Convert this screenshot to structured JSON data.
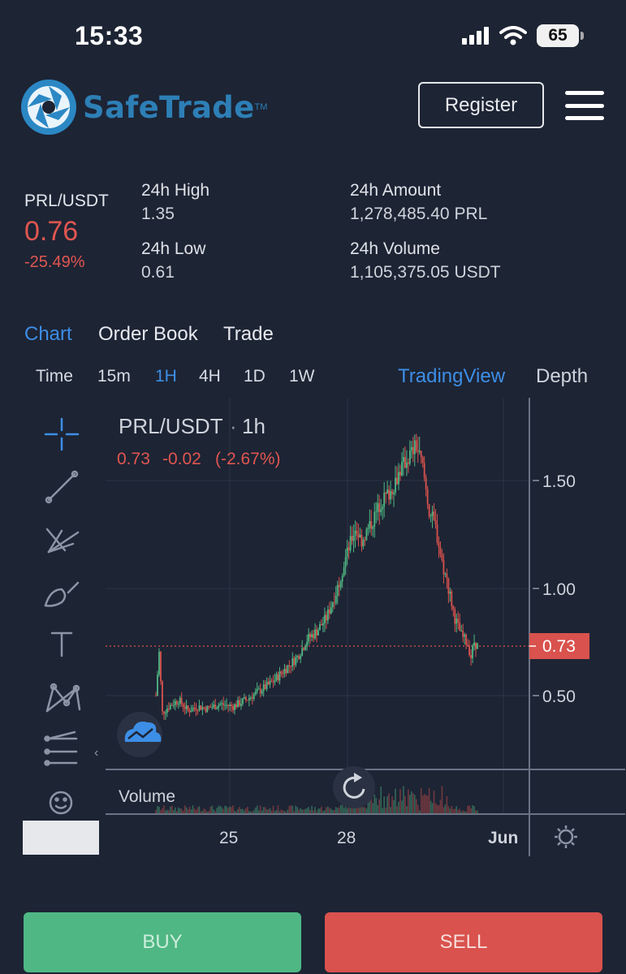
{
  "status_bar": {
    "time": "15:33",
    "battery": "65"
  },
  "header": {
    "logo_text": "SafeTrade",
    "logo_tm": "TM",
    "register_label": "Register"
  },
  "ticker": {
    "pair": "PRL/USDT",
    "price": "0.76",
    "change": "-25.49%",
    "stats": [
      {
        "label": "24h High",
        "value": "1.35"
      },
      {
        "label": "24h Low",
        "value": "0.61"
      },
      {
        "label": "24h Amount",
        "value": "1,278,485.40 PRL"
      },
      {
        "label": "24h Volume",
        "value": "1,105,375.05 USDT"
      }
    ]
  },
  "tabs": [
    "Chart",
    "Order Book",
    "Trade"
  ],
  "active_tab": "Chart",
  "intervals": [
    "Time",
    "15m",
    "1H",
    "4H",
    "1D",
    "1W"
  ],
  "active_interval": "1H",
  "chart_views": {
    "tradingview": "TradingView",
    "depth": "Depth"
  },
  "chart": {
    "symbol": "PRL/USDT",
    "interval": "1h",
    "last": "0.73",
    "change_abs": "-0.02",
    "change_pct": "(-2.67%)",
    "price_ticks": [
      "1.50",
      "1.00",
      "0.50"
    ],
    "current_price_label": "0.73",
    "volume_label": "Volume",
    "date_ticks": [
      "25",
      "28",
      "Jun"
    ]
  },
  "colors": {
    "up": "#4fb784",
    "down": "#d9524d",
    "accent": "#3d8ee6",
    "background": "#1d2434"
  },
  "chart_data": {
    "type": "candlestick",
    "ylim": [
      0.3,
      1.7
    ],
    "x_ticks": [
      "25",
      "28",
      "Jun"
    ],
    "y_ticks": [
      0.5,
      1.0,
      1.5
    ],
    "last_price": 0.73,
    "path": [
      [
        0,
        0.5
      ],
      [
        2,
        0.7
      ],
      [
        4,
        0.42
      ],
      [
        8,
        0.45
      ],
      [
        14,
        0.48
      ],
      [
        20,
        0.43
      ],
      [
        26,
        0.45
      ],
      [
        32,
        0.44
      ],
      [
        40,
        0.46
      ],
      [
        48,
        0.45
      ],
      [
        56,
        0.48
      ],
      [
        64,
        0.52
      ],
      [
        72,
        0.56
      ],
      [
        80,
        0.62
      ],
      [
        88,
        0.68
      ],
      [
        94,
        0.76
      ],
      [
        100,
        0.8
      ],
      [
        106,
        0.86
      ],
      [
        112,
        0.98
      ],
      [
        118,
        1.14
      ],
      [
        124,
        1.28
      ],
      [
        128,
        1.22
      ],
      [
        134,
        1.3
      ],
      [
        140,
        1.4
      ],
      [
        146,
        1.45
      ],
      [
        152,
        1.55
      ],
      [
        158,
        1.62
      ],
      [
        162,
        1.66
      ],
      [
        166,
        1.56
      ],
      [
        170,
        1.36
      ],
      [
        174,
        1.28
      ],
      [
        178,
        1.12
      ],
      [
        182,
        1.0
      ],
      [
        186,
        0.86
      ],
      [
        190,
        0.78
      ],
      [
        194,
        0.74
      ],
      [
        196,
        0.68
      ],
      [
        198,
        0.75
      ],
      [
        200,
        0.73
      ]
    ]
  }
}
